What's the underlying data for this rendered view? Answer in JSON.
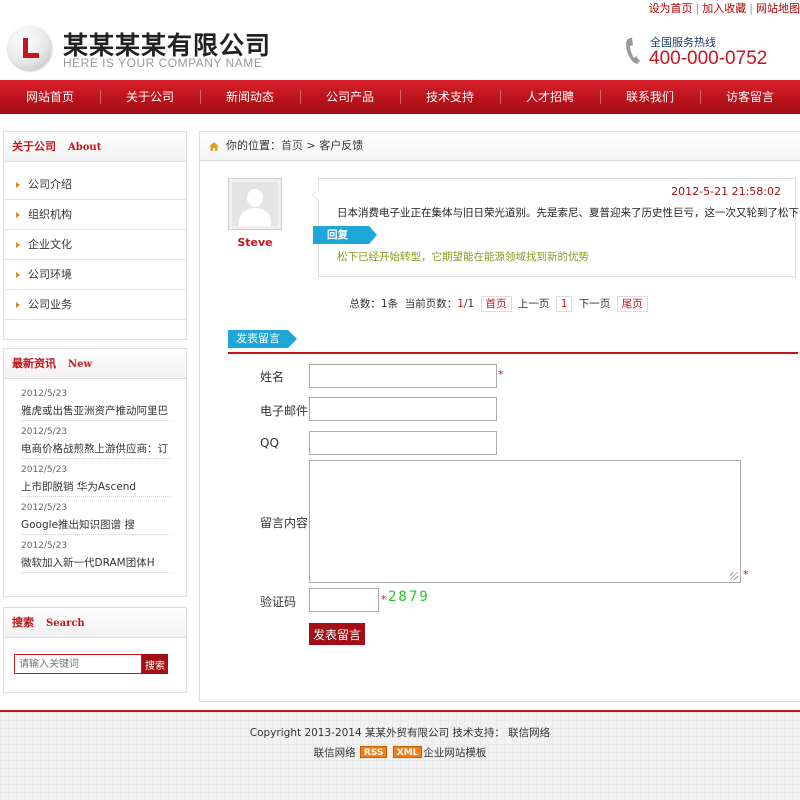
{
  "toplinks": {
    "home": "设为首页",
    "fav": "加入收藏",
    "sitemap": "网站地图"
  },
  "header": {
    "company": "某某某某有限公司",
    "subtitle": "HERE IS YOUR COMPANY NAME",
    "hotline_label": "全国服务热线",
    "hotline": "400-000-0752"
  },
  "nav": [
    "网站首页",
    "关于公司",
    "新闻动态",
    "公司产品",
    "技术支持",
    "人才招聘",
    "联系我们",
    "访客留言"
  ],
  "about": {
    "title": "关于公司",
    "title_en": "About",
    "items": [
      "公司介绍",
      "组织机构",
      "企业文化",
      "公司环境",
      "公司业务"
    ]
  },
  "news": {
    "title": "最新资讯",
    "title_en": "New",
    "items": [
      {
        "date": "2012/5/23",
        "title": "雅虎或出售亚洲资产推动阿里巴"
      },
      {
        "date": "2012/5/23",
        "title": "电商价格战煎熬上游供应商：订"
      },
      {
        "date": "2012/5/23",
        "title": "上市即脱销 华为Ascend"
      },
      {
        "date": "2012/5/23",
        "title": "Google推出知识图谱 搜"
      },
      {
        "date": "2012/5/23",
        "title": "微软加入新一代DRAM团体H"
      }
    ]
  },
  "search": {
    "title": "搜索",
    "title_en": "Search",
    "placeholder": "请输入关键词",
    "button": "搜索"
  },
  "breadcrumb": {
    "prefix": "你的位置：",
    "home": "首页",
    "sep": " > ",
    "current": "客户反馈"
  },
  "message": {
    "author": "Steve",
    "time": "2012-5-21 21:58:02",
    "body": "日本消费电子业正在集体与旧日荣光道别。先是索尼、夏普迎来了历史性巨亏，这一次又轮到了松下",
    "reply_label": "回复",
    "reply": "松下已经开始转型，它期望能在能源领域找到新的优势"
  },
  "pager": {
    "total_label": "总数：",
    "total": "1",
    "unit": "条",
    "cur_label": "当前页数：",
    "cur": "1",
    "slash": "/",
    "pages": "1",
    "first": "首页",
    "prev": "上一页",
    "page1": "1",
    "next": "下一页",
    "last": "尾页"
  },
  "form": {
    "section_title": "发表留言",
    "name_label": "姓名",
    "email_label": "电子邮件",
    "qq_label": "QQ",
    "content_label": "留言内容",
    "captcha_label": "验证码",
    "captcha": "2879",
    "required_mark": "*",
    "submit": "发表留言"
  },
  "footer": {
    "copyright": "Copyright 2013-2014 某某外贸有限公司 技术支持： 联信网络",
    "brand": "联信网络",
    "rss": "RSS",
    "xml": "XML",
    "template": "企业网站模板"
  },
  "colors": {
    "brand_red": "#c4161c",
    "accent_blue": "#1ea6d8",
    "captcha_green": "#22cc22"
  }
}
